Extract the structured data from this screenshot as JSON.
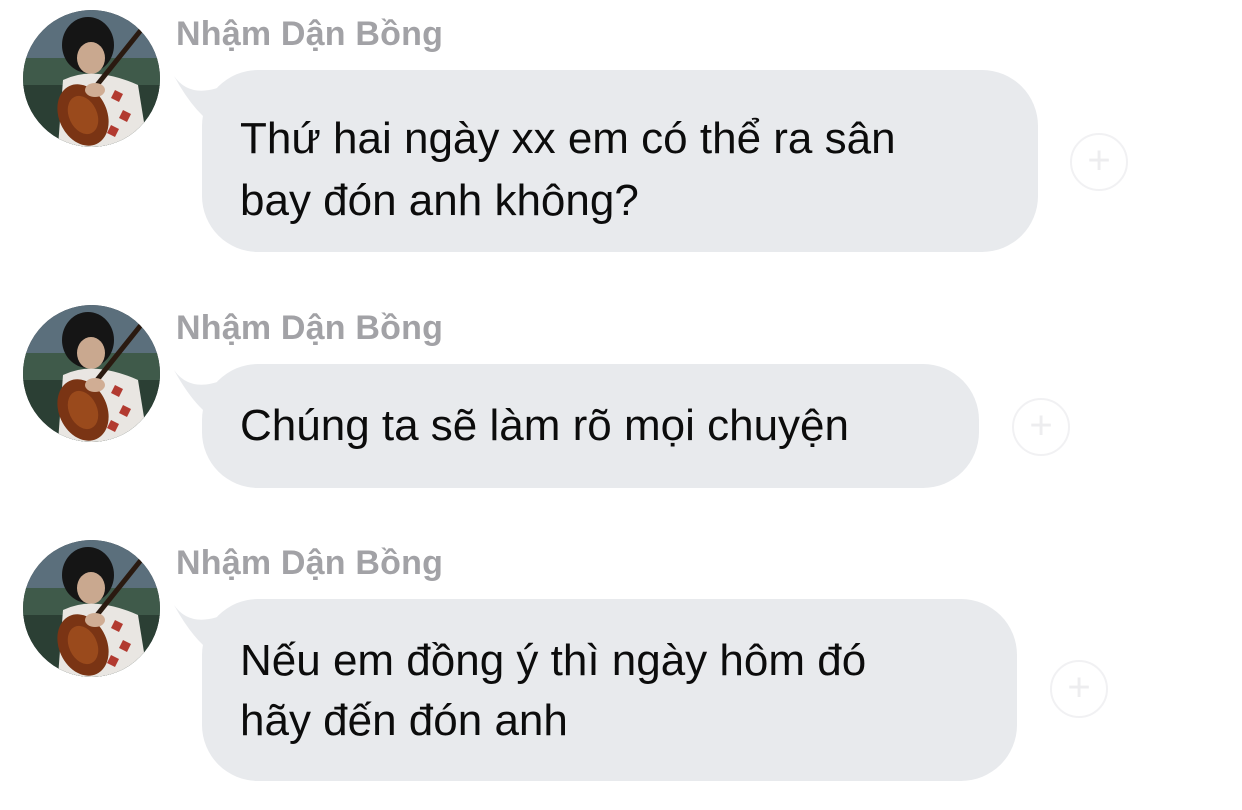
{
  "messages": [
    {
      "sender": "Nhậm Dận Bồng",
      "text": "Thứ hai ngày xx em có thể ra sân\nbay đón anh không?",
      "react_icon": "+"
    },
    {
      "sender": "Nhậm Dận Bồng",
      "text": "Chúng ta sẽ làm rõ mọi chuyện",
      "react_icon": "+"
    },
    {
      "sender": "Nhậm Dận Bồng",
      "text": "Nếu em đồng ý thì ngày hôm đó\nhãy đến đón anh",
      "react_icon": "+"
    }
  ]
}
